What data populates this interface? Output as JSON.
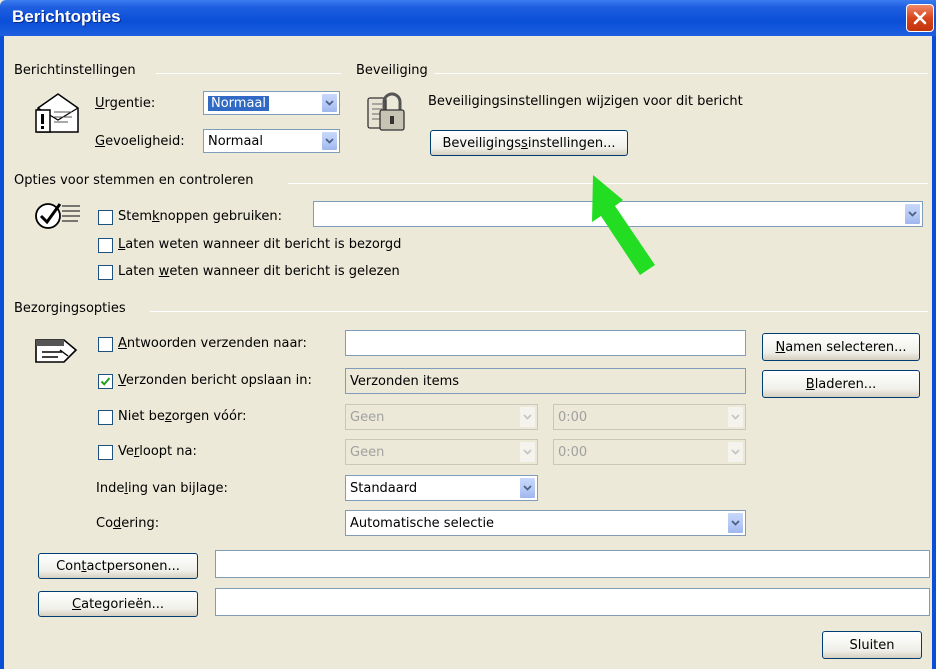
{
  "window": {
    "title": "Berichtopties"
  },
  "message_settings": {
    "heading": "Berichtinstellingen",
    "urgency_label_pre": "",
    "urgency_label_key": "U",
    "urgency_label_post": "rgentie:",
    "urgency_value": "Normaal",
    "sensitivity_label_key": "G",
    "sensitivity_label_post": "evoeligheid:",
    "sensitivity_value": "Normaal"
  },
  "security": {
    "heading": "Beveiliging",
    "description": "Beveiligingsinstellingen wijzigen voor dit bericht",
    "button_pre": "Beveiligings",
    "button_key": "s",
    "button_post": "instellingen..."
  },
  "voting": {
    "heading": "Opties voor stemmen en controleren",
    "use_buttons_pre": "Stem",
    "use_buttons_key": "k",
    "use_buttons_post": "noppen gebruiken:",
    "use_buttons_value": "",
    "delivered_key": "L",
    "delivered_post": "aten weten wanneer dit bericht is bezorgd",
    "read_pre": "Laten ",
    "read_key": "w",
    "read_post": "eten wanneer dit bericht is gelezen"
  },
  "delivery": {
    "heading": "Bezorgingsopties",
    "replies_key": "A",
    "replies_post": "ntwoorden verzenden naar:",
    "replies_value": "",
    "select_names_key": "N",
    "select_names_post": "amen selecteren...",
    "save_sent_key": "V",
    "save_sent_post": "erzonden bericht opslaan in:",
    "save_sent_value": "Verzonden items",
    "browse_key": "B",
    "browse_post": "laderen...",
    "not_before_pre": "Niet be",
    "not_before_key": "z",
    "not_before_post": "orgen vóór:",
    "not_before_date": "Geen",
    "not_before_time": "0:00",
    "expires_pre": "Ve",
    "expires_key": "r",
    "expires_post": "loopt na:",
    "expires_date": "Geen",
    "expires_time": "0:00",
    "attachment_pre": "Inde",
    "attachment_key": "l",
    "attachment_post": "ing van bijlage:",
    "attachment_value": "Standaard",
    "encoding_pre": "Co",
    "encoding_key": "d",
    "encoding_post": "ering:",
    "encoding_value": "Automatische selectie"
  },
  "footer": {
    "contacts_pre": "Con",
    "contacts_key": "t",
    "contacts_post": "actpersonen...",
    "contacts_value": "",
    "categories_key": "C",
    "categories_post": "ategorieën...",
    "categories_value": "",
    "close_label": "Sluiten"
  },
  "annotation": {
    "arrow_color": "#22dd22"
  }
}
